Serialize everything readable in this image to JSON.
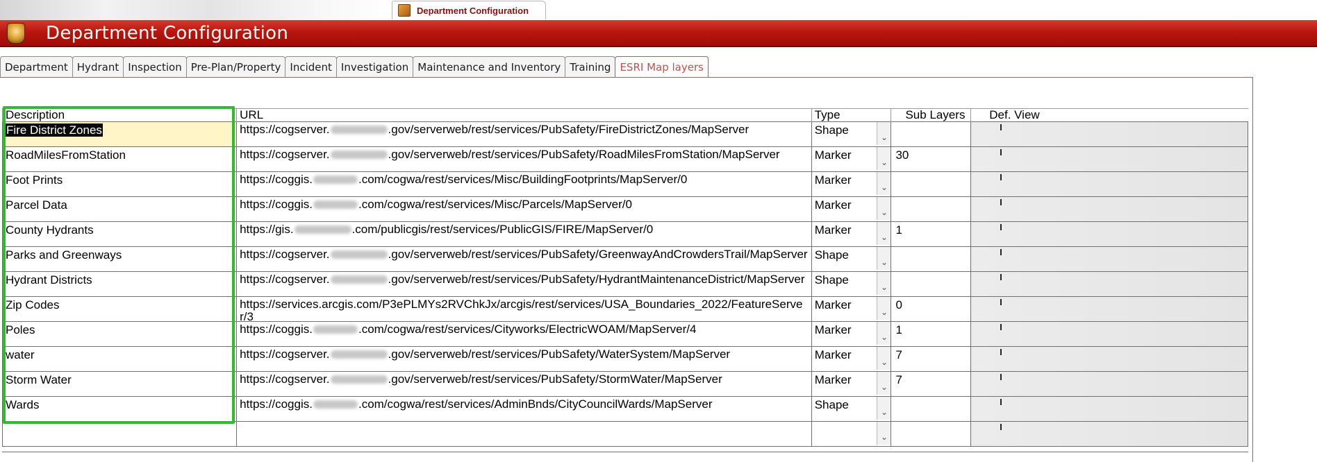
{
  "document_tab": {
    "label": "Department Configuration",
    "icon": "config-icon"
  },
  "header": {
    "title": "Department Configuration",
    "icon": "department-badge-icon"
  },
  "tabs": [
    {
      "label": "Department",
      "active": false
    },
    {
      "label": "Hydrant",
      "active": false
    },
    {
      "label": "Inspection",
      "active": false
    },
    {
      "label": "Pre-Plan/Property",
      "active": false
    },
    {
      "label": "Incident",
      "active": false
    },
    {
      "label": "Investigation",
      "active": false
    },
    {
      "label": "Maintenance and Inventory",
      "active": false
    },
    {
      "label": "Training",
      "active": false
    },
    {
      "label": "ESRI Map layers",
      "active": true
    }
  ],
  "grid": {
    "columns": {
      "description": "Description",
      "url": "URL",
      "type": "Type",
      "sub_layers": "Sub Layers",
      "def_view": "Def. View"
    },
    "rows": [
      {
        "description": "Fire District Zones",
        "url_pre": "https://cogserver.",
        "url_post": ".gov/serverweb/rest/services/PubSafety/FireDistrictZones/MapServer",
        "type": "Shape",
        "sub_layers": ""
      },
      {
        "description": "RoadMilesFromStation",
        "url_pre": "https://cogserver.",
        "url_post": ".gov/serverweb/rest/services/PubSafety/RoadMilesFromStation/MapServer",
        "type": "Marker",
        "sub_layers": "30"
      },
      {
        "description": "Foot Prints",
        "url_pre": "https://coggis.",
        "url_post": ".com/cogwa/rest/services/Misc/BuildingFootprints/MapServer/0",
        "type": "Marker",
        "sub_layers": ""
      },
      {
        "description": "Parcel Data",
        "url_pre": "https://coggis.",
        "url_post": ".com/cogwa/rest/services/Misc/Parcels/MapServer/0",
        "type": "Marker",
        "sub_layers": ""
      },
      {
        "description": "County Hydrants",
        "url_pre": "https://gis.",
        "url_post": ".com/publicgis/rest/services/PublicGIS/FIRE/MapServer/0",
        "type": "Marker",
        "sub_layers": "1"
      },
      {
        "description": "Parks and Greenways",
        "url_pre": "https://cogserver.",
        "url_post": ".gov/serverweb/rest/services/PubSafety/GreenwayAndCrowdersTrail/MapServer",
        "type": "Shape",
        "sub_layers": ""
      },
      {
        "description": "Hydrant Districts",
        "url_pre": "https://cogserver.",
        "url_post": ".gov/serverweb/rest/services/PubSafety/HydrantMaintenanceDistrict/MapServer",
        "type": "Shape",
        "sub_layers": ""
      },
      {
        "description": "Zip Codes",
        "url_pre": "https://services.arcgis.com/P3ePLMYs2RVChkJx/arcgis/rest/services/USA_Boundaries_2022/FeatureServer/3",
        "url_post": "",
        "type": "Marker",
        "sub_layers": "0"
      },
      {
        "description": "Poles",
        "url_pre": "https://coggis.",
        "url_post": ".com/cogwa/rest/services/Cityworks/ElectricWOAM/MapServer/4",
        "type": "Marker",
        "sub_layers": "1"
      },
      {
        "description": "water",
        "url_pre": "https://cogserver.",
        "url_post": ".gov/serverweb/rest/services/PubSafety/WaterSystem/MapServer",
        "type": "Marker",
        "sub_layers": "7"
      },
      {
        "description": "Storm Water",
        "url_pre": "https://cogserver.",
        "url_post": ".gov/serverweb/rest/services/PubSafety/StormWater/MapServer",
        "type": "Marker",
        "sub_layers": "7"
      },
      {
        "description": "Wards",
        "url_pre": "https://coggis.",
        "url_post": ".com/cogwa/rest/services/AdminBnds/CityCouncilWards/MapServer",
        "type": "Shape",
        "sub_layers": ""
      },
      {
        "description": "",
        "url_pre": "",
        "url_post": "",
        "type": "",
        "sub_layers": ""
      }
    ]
  }
}
